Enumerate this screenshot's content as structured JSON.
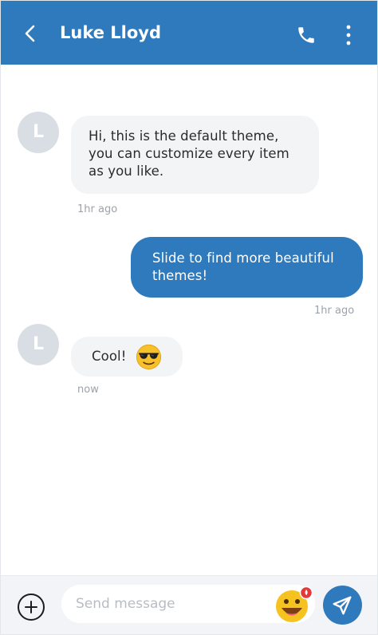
{
  "header": {
    "title": "Luke Lloyd",
    "back_icon": "chevron-left-icon",
    "call_icon": "phone-icon",
    "menu_icon": "more-vertical-icon"
  },
  "messages": [
    {
      "direction": "incoming",
      "avatar_initial": "L",
      "text": "Hi, this is the default theme, you can customize every item as you like.",
      "time": "1hr ago"
    },
    {
      "direction": "outgoing",
      "text": "Slide to find more beautiful themes!",
      "time": "1hr ago"
    },
    {
      "direction": "incoming",
      "avatar_initial": "L",
      "text": "Cool!",
      "emoji": "sunglasses-emoji",
      "time": "now"
    }
  ],
  "composer": {
    "placeholder": "Send message",
    "value": "",
    "add_icon": "plus-circle-icon",
    "emoji_icon": "emoji-picker-icon",
    "send_icon": "send-icon"
  },
  "colors": {
    "accent": "#2f7abd",
    "incoming_bubble": "#f3f4f6",
    "avatar_bg": "#d9dee4",
    "timestamp": "#9da3aa"
  }
}
